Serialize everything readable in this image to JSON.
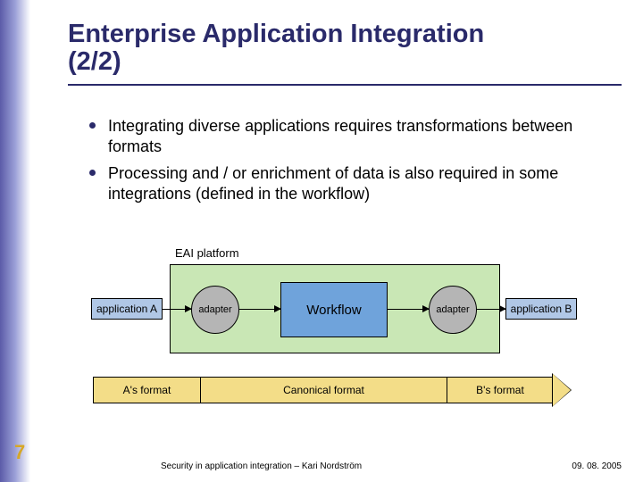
{
  "title": "Enterprise Application Integration",
  "counter": "(2/2)",
  "bullets": [
    "Integrating diverse applications requires transformations between formats",
    "Processing and / or enrichment of data is also required in some integrations (defined in the workflow)"
  ],
  "diagram": {
    "eai_label": "EAI platform",
    "app_a": "application A",
    "app_b": "application B",
    "adapter_left": "adapter",
    "adapter_right": "adapter",
    "workflow": "Workflow",
    "format_a": "A's format",
    "format_canonical": "Canonical format",
    "format_b": "B's format"
  },
  "page_number": "7",
  "footer_left": "Security in application integration – Kari Nordström",
  "footer_right": "09. 08. 2005"
}
